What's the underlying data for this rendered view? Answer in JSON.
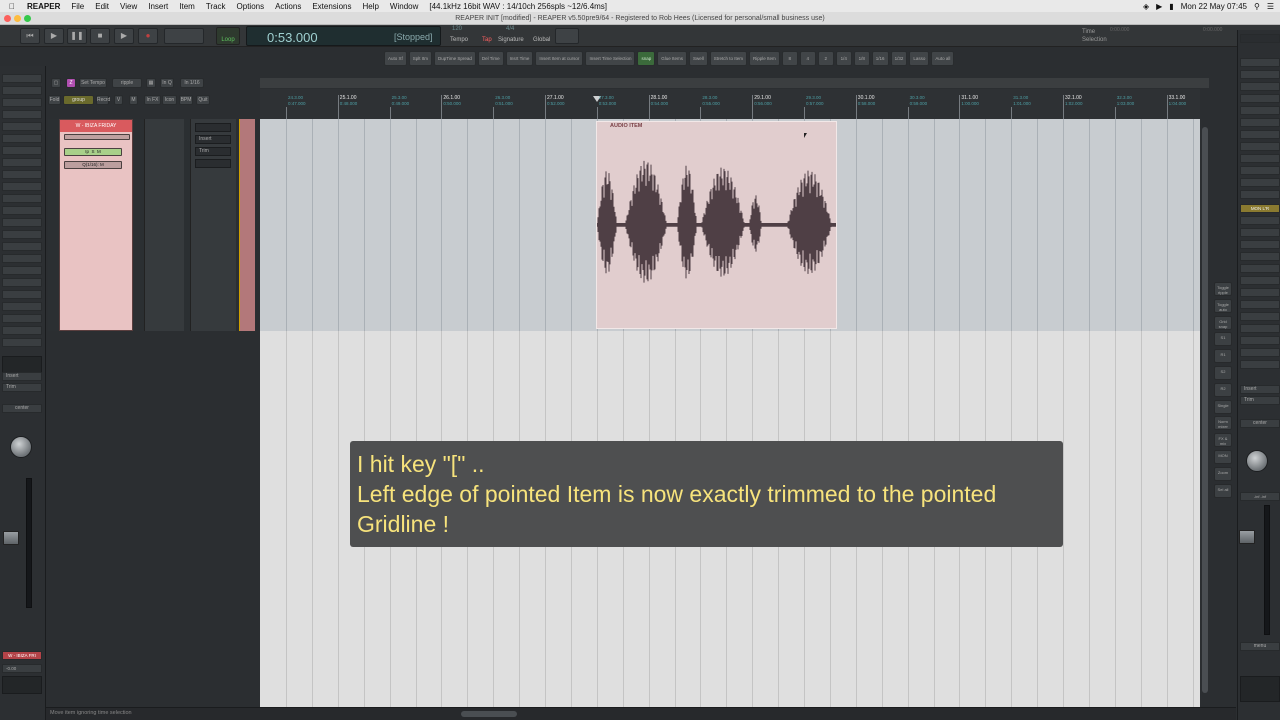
{
  "menubar": {
    "app": "REAPER",
    "items": [
      "File",
      "Edit",
      "View",
      "Insert",
      "Item",
      "Track",
      "Options",
      "Actions",
      "Extensions",
      "Help",
      "Window",
      "[44.1kHz 16bit WAV : 14/10ch 256spls ~12/6.4ms]"
    ],
    "clock": "Mon 22 May  07:45"
  },
  "window": {
    "title": "REAPER INIT [modified] - REAPER v5.50pre9/64 - Registered to Rob Hees (Licensed for personal/small business use)"
  },
  "transport": {
    "loop_label": "Loop",
    "time": "0:53.000",
    "state": "[Stopped]",
    "tempo_value": "120",
    "tempo_label": "Tempo",
    "tap_label": "Tap",
    "sig_value": "4/4",
    "sig_label": "Signature",
    "global_label": "Global",
    "time_label": "Time",
    "selection_label": "Selection",
    "sel_start": "0:00.000",
    "sel_end": "0:00.000"
  },
  "actions": [
    {
      "label": "Auto Xf",
      "green": false
    },
    {
      "label": "Splt Itm",
      "green": false
    },
    {
      "label": "DupTime Spread",
      "green": false
    },
    {
      "label": "Del Time",
      "green": false
    },
    {
      "label": "Insrt Time",
      "green": false
    },
    {
      "label": "Insert Item at cursor",
      "green": false
    },
    {
      "label": "Insert Time Selection",
      "green": false
    },
    {
      "label": "snap",
      "green": true
    },
    {
      "label": "Glue Items",
      "green": false
    },
    {
      "label": "Swell",
      "green": false
    },
    {
      "label": "Stretch to Item",
      "green": false
    },
    {
      "label": "Ripple Item",
      "green": false
    },
    {
      "label": "8",
      "green": false
    },
    {
      "label": "4",
      "green": false
    },
    {
      "label": "2",
      "green": false
    },
    {
      "label": "1/4",
      "green": false
    },
    {
      "label": "1/8",
      "green": false
    },
    {
      "label": "1/16",
      "green": false
    },
    {
      "label": "1/32",
      "green": false
    },
    {
      "label": "Lasso",
      "green": false
    },
    {
      "label": "Auto all",
      "green": false
    }
  ],
  "tcp_bar": {
    "set_tempo": "Set Tempo",
    "ripple": "ripple",
    "group": "group",
    "in_q": "In Q",
    "in_16th": "In 1/16",
    "fold": "Fold",
    "add": "+",
    "rcrd": "Recrd",
    "v": "V",
    "m": "M",
    "in_fx": "In FX",
    "icon": "Icon",
    "bpm": "BPM",
    "quit": "Quit"
  },
  "timeline": {
    "ticks": [
      {
        "label": "",
        "sub": "24.3.00",
        "sub2": "0:47.000"
      },
      {
        "label": "25.1.00",
        "sub": "",
        "sub2": "0:48.000"
      },
      {
        "label": "",
        "sub": "25.3.00",
        "sub2": "0:49.000"
      },
      {
        "label": "26.1.00",
        "sub": "",
        "sub2": "0:50.000"
      },
      {
        "label": "",
        "sub": "26.3.00",
        "sub2": "0:51.000"
      },
      {
        "label": "27.1.00",
        "sub": "",
        "sub2": "0:52.000"
      },
      {
        "label": "",
        "sub": "27.3.00",
        "sub2": "0:53.000"
      },
      {
        "label": "28.1.00",
        "sub": "",
        "sub2": "0:54.000"
      },
      {
        "label": "",
        "sub": "28.3.00",
        "sub2": "0:55.000"
      },
      {
        "label": "29.1.00",
        "sub": "",
        "sub2": "0:56.000"
      },
      {
        "label": "",
        "sub": "29.3.00",
        "sub2": "0:57.000"
      },
      {
        "label": "30.1.00",
        "sub": "",
        "sub2": "0:58.000"
      },
      {
        "label": "",
        "sub": "30.3.00",
        "sub2": "0:59.000"
      },
      {
        "label": "31.1.00",
        "sub": "",
        "sub2": "1:00.000"
      },
      {
        "label": "",
        "sub": "31.3.00",
        "sub2": "1:01.000"
      },
      {
        "label": "32.1.00",
        "sub": "",
        "sub2": "1:02.000"
      },
      {
        "label": "",
        "sub": "32.3.00",
        "sub2": "1:03.000"
      },
      {
        "label": "33.1.00",
        "sub": "",
        "sub2": "1:04.000"
      }
    ]
  },
  "track": {
    "name": "W - IBIZA FRIDAY",
    "fx_insert": "Insert",
    "fx_trim": "Trim",
    "in_label": "Q(1/16): M",
    "item_name": "AUDIO ITEM"
  },
  "mixer": {
    "insert": "Insert",
    "trim": "Trim",
    "pan": "center",
    "track_name": "W - IBIZA FRI",
    "master_label": "MON L'R",
    "menu": "menu",
    "val": "-inf -inf",
    "num": "-0.00"
  },
  "right_toolbar": [
    "Toggle ripple",
    "Toggle auto",
    "Grid snap",
    "S1",
    "R1",
    "S2",
    "R2",
    "Single",
    "Norm mixer",
    "FX & mix",
    "MON",
    "Zoom",
    "Sel all"
  ],
  "callout": {
    "line1": "I hit key \"[\" ..",
    "line2": "Left edge of pointed Item is now exactly trimmed to the pointed",
    "line3": "Gridline !"
  },
  "status": {
    "text": "Move item ignoring time selection"
  },
  "colors": {
    "item_bg": "#e1cdce",
    "waveform": "#4f3f45",
    "callout_text": "#f7e37c",
    "track_header": "#d95a5e"
  }
}
